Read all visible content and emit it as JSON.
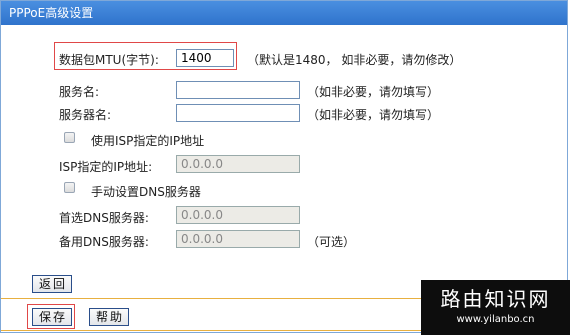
{
  "title": "PPPoE高级设置",
  "mtu": {
    "label": "数据包MTU(字节):",
    "value": "1400",
    "hint": "（默认是1480，  如非必要，请勿修改）"
  },
  "service_name": {
    "label": "服务名:",
    "value": "",
    "hint": "（如非必要，请勿填写）"
  },
  "server_name": {
    "label": "服务器名:",
    "value": "",
    "hint": "（如非必要，请勿填写）"
  },
  "use_isp_ip": {
    "label": "使用ISP指定的IP地址",
    "checked": false
  },
  "isp_ip": {
    "label": "ISP指定的IP地址:",
    "value": "0.0.0.0"
  },
  "manual_dns": {
    "label": "手动设置DNS服务器",
    "checked": false
  },
  "primary_dns": {
    "label": "首选DNS服务器:",
    "value": "0.0.0.0"
  },
  "secondary_dns": {
    "label": "备用DNS服务器:",
    "value": "0.0.0.0",
    "hint": "（可选）"
  },
  "buttons": {
    "back": "返回",
    "save": "保存",
    "help": "帮助"
  },
  "watermark": {
    "title": "路由知识网",
    "url": "www.yilanbo.cn"
  },
  "colors": {
    "titlebar": "#2f73cc",
    "highlight": "#e04848",
    "divider": "#e8b040"
  }
}
